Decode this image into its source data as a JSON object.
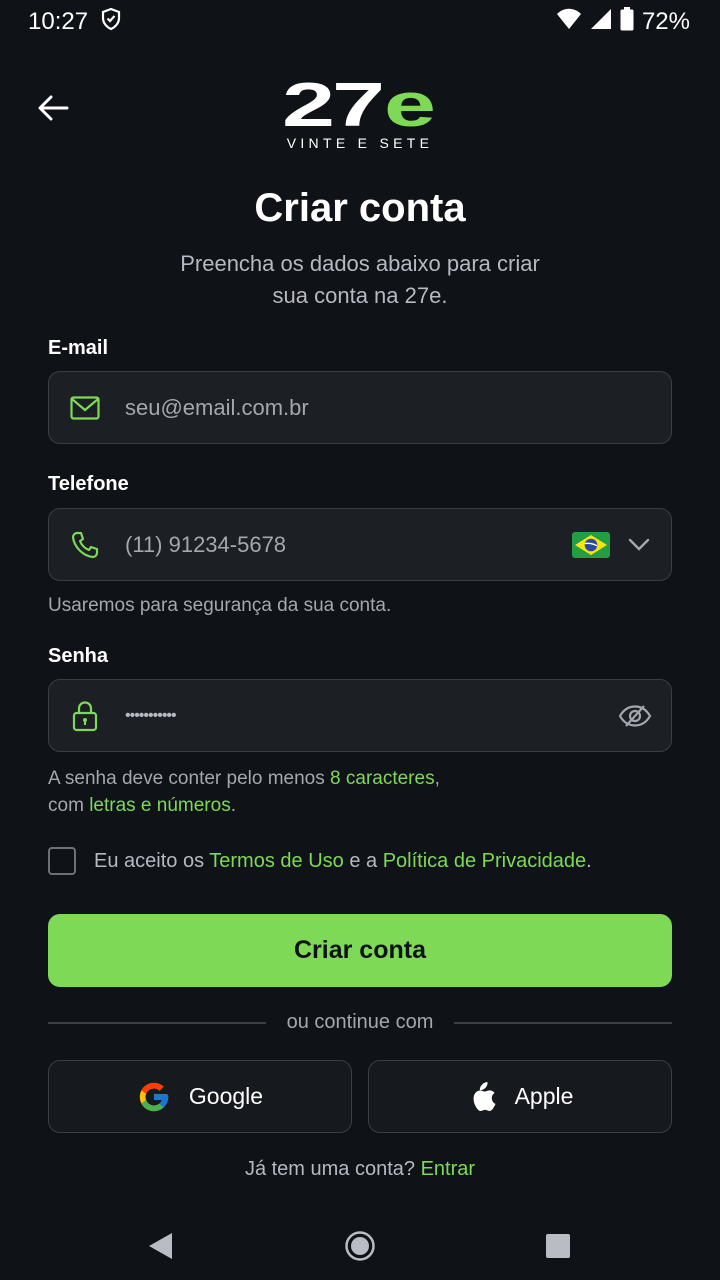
{
  "status": {
    "time": "10:27",
    "battery": "72%"
  },
  "brand": {
    "logo_text": "27e",
    "tagline": "VINTE E SETE"
  },
  "header": {
    "title": "Criar conta",
    "subtitle": "Preencha os dados abaixo para criar sua conta na 27e."
  },
  "form": {
    "email": {
      "label": "E-mail",
      "placeholder": "seu@email.com.br"
    },
    "phone": {
      "label": "Telefone",
      "placeholder": "(11) 91234-5678",
      "hint": "Usaremos para segurança da sua conta."
    },
    "password": {
      "label": "Senha",
      "value": "•••••••••••",
      "hint_1": "A senha deve conter pelo menos ",
      "hint_1_highlight": "8 caracteres",
      "hint_1_end": ",",
      "hint_2": "com ",
      "hint_2_highlight": "letras e números",
      "hint_2_end": "."
    },
    "terms": {
      "prefix": "Eu aceito os ",
      "terms_link": "Termos de Uso",
      "middle": " e a ",
      "privacy_link": "Política de Privacidade",
      "suffix": "."
    },
    "submit_label": "Criar conta"
  },
  "social": {
    "divider": "ou continue com",
    "google": "Google",
    "apple": "Apple"
  },
  "footer": {
    "question": "Já tem uma conta? ",
    "login_link": "Entrar"
  },
  "colors": {
    "accent": "#7ed957",
    "background": "#0f1217",
    "field": "#1c1f24"
  }
}
